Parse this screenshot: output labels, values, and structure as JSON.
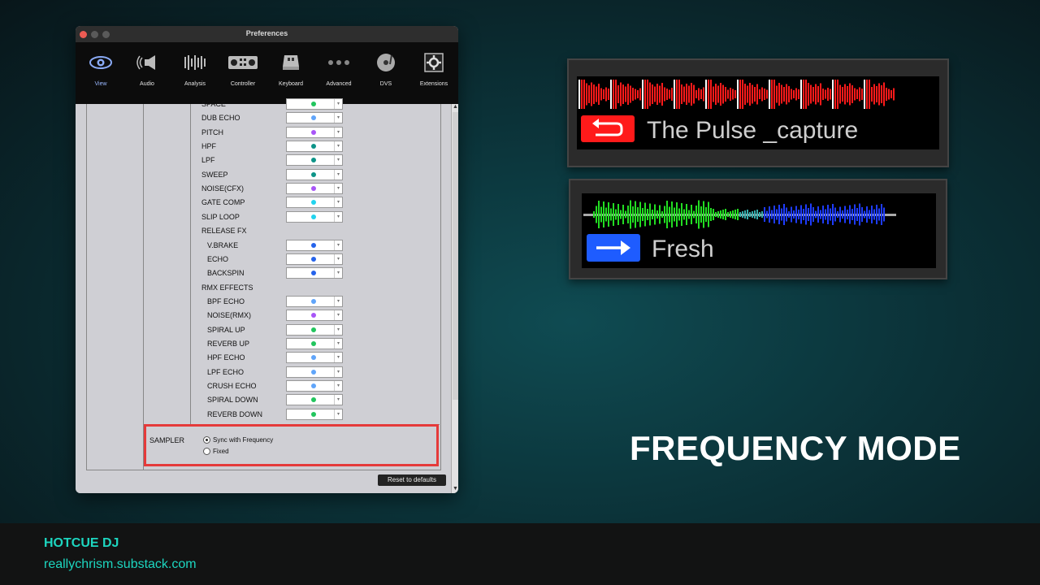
{
  "window": {
    "title": "Preferences",
    "tabs": [
      {
        "label": "View",
        "icon": "eye-icon"
      },
      {
        "label": "Audio",
        "icon": "speaker-icon"
      },
      {
        "label": "Analysis",
        "icon": "bars-icon"
      },
      {
        "label": "Controller",
        "icon": "controller-icon"
      },
      {
        "label": "Keyboard",
        "icon": "keyboard-icon"
      },
      {
        "label": "Advanced",
        "icon": "dots-icon"
      },
      {
        "label": "DVS",
        "icon": "turntable-icon"
      },
      {
        "label": "Extensions",
        "icon": "puzzle-icon"
      }
    ],
    "active_tab": "View",
    "fx_rows": [
      {
        "label": "SPACE",
        "color": "#22c55e",
        "indent": false
      },
      {
        "label": "DUB ECHO",
        "color": "#60a5fa",
        "indent": false
      },
      {
        "label": "PITCH",
        "color": "#a855f7",
        "indent": false
      },
      {
        "label": "HPF",
        "color": "#0d9488",
        "indent": false
      },
      {
        "label": "LPF",
        "color": "#0d9488",
        "indent": false
      },
      {
        "label": "SWEEP",
        "color": "#0d9488",
        "indent": false
      },
      {
        "label": "NOISE(CFX)",
        "color": "#a855f7",
        "indent": false
      },
      {
        "label": "GATE COMP",
        "color": "#22d3ee",
        "indent": false
      },
      {
        "label": "SLIP LOOP",
        "color": "#22d3ee",
        "indent": false
      },
      {
        "label": "RELEASE FX",
        "color": null,
        "indent": false
      },
      {
        "label": "V.BRAKE",
        "color": "#2563eb",
        "indent": true
      },
      {
        "label": "ECHO",
        "color": "#2563eb",
        "indent": true
      },
      {
        "label": "BACKSPIN",
        "color": "#2563eb",
        "indent": true
      },
      {
        "label": "RMX EFFECTS",
        "color": null,
        "indent": false
      },
      {
        "label": "BPF ECHO",
        "color": "#60a5fa",
        "indent": true
      },
      {
        "label": "NOISE(RMX)",
        "color": "#a855f7",
        "indent": true
      },
      {
        "label": "SPIRAL UP",
        "color": "#22c55e",
        "indent": true
      },
      {
        "label": "REVERB UP",
        "color": "#22c55e",
        "indent": true
      },
      {
        "label": "HPF ECHO",
        "color": "#60a5fa",
        "indent": true
      },
      {
        "label": "LPF ECHO",
        "color": "#60a5fa",
        "indent": true
      },
      {
        "label": "CRUSH ECHO",
        "color": "#60a5fa",
        "indent": true
      },
      {
        "label": "SPIRAL DOWN",
        "color": "#22c55e",
        "indent": true
      },
      {
        "label": "REVERB DOWN",
        "color": "#22c55e",
        "indent": true
      }
    ],
    "sampler": {
      "label": "SAMPLER",
      "options": [
        "Sync with Frequency",
        "Fixed"
      ],
      "selected": "Sync with Frequency"
    },
    "reset_label": "Reset to defaults"
  },
  "panels": [
    {
      "title": "The Pulse _capture",
      "cue_color": "#ff1a1a",
      "cue_icon": "loop-back-icon",
      "wave": "red"
    },
    {
      "title": "Fresh",
      "cue_color": "#1e5cff",
      "cue_icon": "arrow-right-icon",
      "wave": "green-blue"
    }
  ],
  "mode_title": "FREQUENCY MODE",
  "footer": {
    "brand": "HOTCUE DJ",
    "site": "reallychrism.substack.com"
  }
}
